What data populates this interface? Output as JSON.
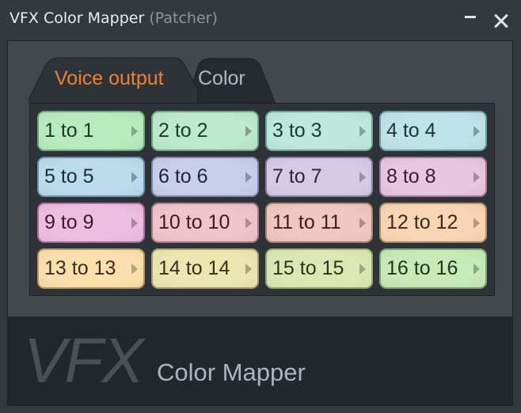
{
  "window": {
    "title": "VFX Color Mapper",
    "subtitle": "(Patcher)",
    "minimize_icon": "minimize-icon",
    "close_icon": "close-icon"
  },
  "tabs": [
    {
      "label": "Voice output",
      "active": true,
      "color": "#f08030"
    },
    {
      "label": "Color",
      "active": false,
      "color": "#aebcc6"
    }
  ],
  "mappings": [
    {
      "label": "1 to 1",
      "bg": "#b8ecbe",
      "border": "#6fa77a",
      "text": "#1c3a20",
      "arrow": "#7fa88a"
    },
    {
      "label": "2 to 2",
      "bg": "#bde9cc",
      "border": "#6fa383",
      "text": "#1c3a28",
      "arrow": "#7fa08c"
    },
    {
      "label": "3 to 3",
      "bg": "#bfe8dc",
      "border": "#6ea394",
      "text": "#1c3a33",
      "arrow": "#7ea59a"
    },
    {
      "label": "4 to 4",
      "bg": "#bfe3e8",
      "border": "#6e9ca3",
      "text": "#1c3338",
      "arrow": "#7e9fa5"
    },
    {
      "label": "5 to 5",
      "bg": "#bcdcec",
      "border": "#6f93a8",
      "text": "#1c2c3a",
      "arrow": "#7e96a5"
    },
    {
      "label": "6 to 6",
      "bg": "#c8cfea",
      "border": "#7e86a5",
      "text": "#22263a",
      "arrow": "#8990a8"
    },
    {
      "label": "7 to 7",
      "bg": "#d6cbe6",
      "border": "#8e80a2",
      "text": "#2c233a",
      "arrow": "#9a8fab"
    },
    {
      "label": "8 to 8",
      "bg": "#e8c6e0",
      "border": "#a47a98",
      "text": "#3a1c34",
      "arrow": "#a68a9e"
    },
    {
      "label": "9 to 9",
      "bg": "#ecbedf",
      "border": "#a9709a",
      "text": "#3a1c30",
      "arrow": "#ad849f"
    },
    {
      "label": "10 to 10",
      "bg": "#f0c4cc",
      "border": "#ab7a84",
      "text": "#3a1c22",
      "arrow": "#ad8b90"
    },
    {
      "label": "11 to 11",
      "bg": "#f0c8bd",
      "border": "#ab8075",
      "text": "#3a221c",
      "arrow": "#ad9088"
    },
    {
      "label": "12 to 12",
      "bg": "#f8d6b4",
      "border": "#b38b66",
      "text": "#3a2a1c",
      "arrow": "#b49a80"
    },
    {
      "label": "13 to 13",
      "bg": "#fbe0ae",
      "border": "#b59a62",
      "text": "#3a2e1c",
      "arrow": "#b5a47a"
    },
    {
      "label": "14 to 14",
      "bg": "#ece6b2",
      "border": "#a8a068",
      "text": "#34321c",
      "arrow": "#aaa47a"
    },
    {
      "label": "15 to 15",
      "bg": "#dce8b4",
      "border": "#98a86a",
      "text": "#2c341c",
      "arrow": "#9ca882"
    },
    {
      "label": "16 to 16",
      "bg": "#c6eab8",
      "border": "#80a670",
      "text": "#22361c",
      "arrow": "#8aa682"
    }
  ],
  "footer": {
    "logo_main": "VFX",
    "logo_sub": "Color Mapper"
  }
}
